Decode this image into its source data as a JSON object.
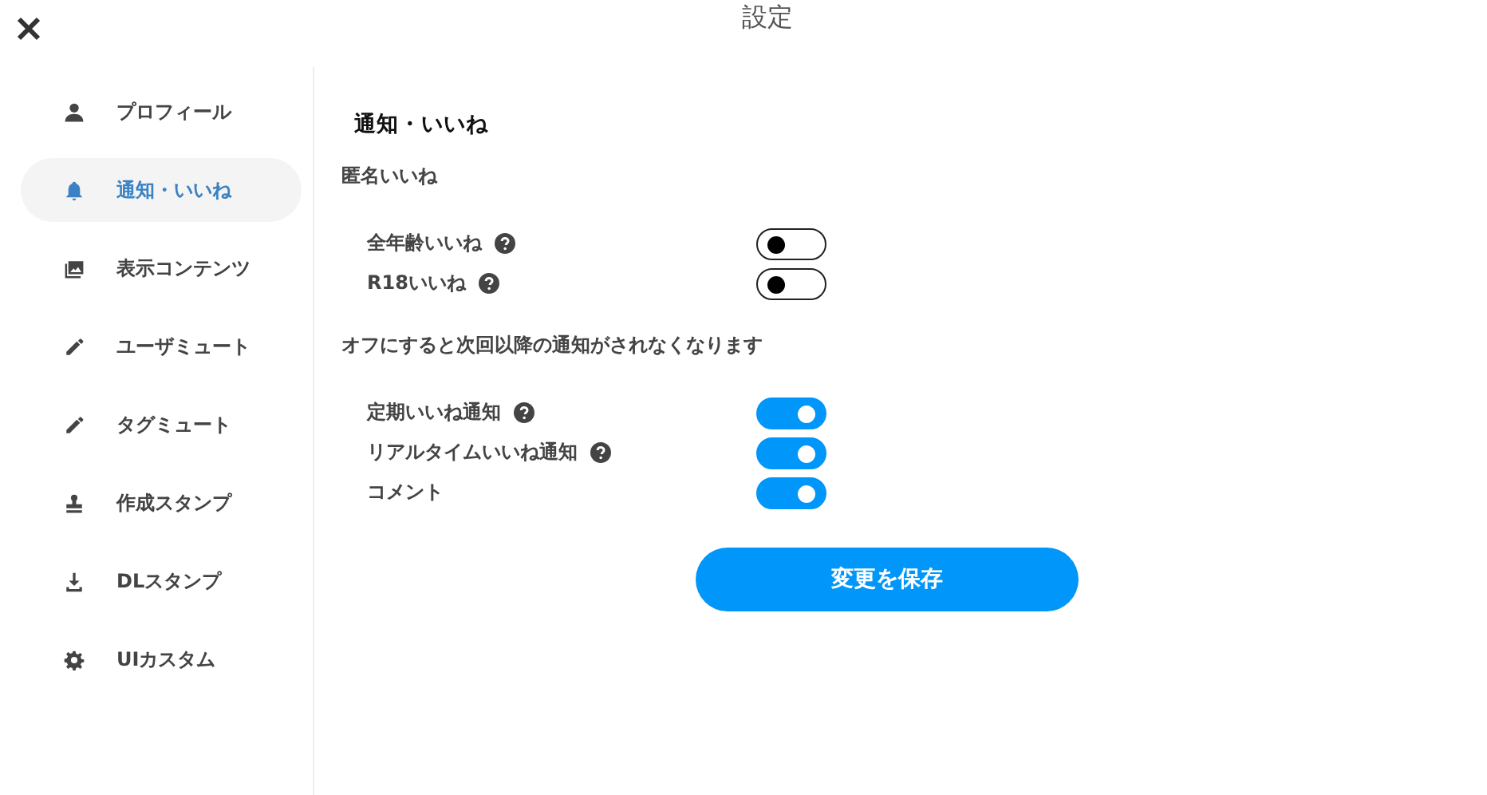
{
  "window": {
    "title": "設定"
  },
  "sidebar": {
    "items": [
      {
        "label": "プロフィール",
        "selected": false
      },
      {
        "label": "通知・いいね",
        "selected": true
      },
      {
        "label": "表示コンテンツ",
        "selected": false
      },
      {
        "label": "ユーザミュート",
        "selected": false
      },
      {
        "label": "タグミュート",
        "selected": false
      },
      {
        "label": "作成スタンプ",
        "selected": false
      },
      {
        "label": "DLスタンプ",
        "selected": false
      },
      {
        "label": "UIカスタム",
        "selected": false
      }
    ]
  },
  "content": {
    "heading": "通知・いいね",
    "sections": [
      {
        "title": "匿名いいね",
        "rows": [
          {
            "label": "全年齢いいね",
            "help": true,
            "on": false
          },
          {
            "label": "R18いいね",
            "help": true,
            "on": false
          }
        ]
      },
      {
        "title": "オフにすると次回以降の通知がされなくなります",
        "rows": [
          {
            "label": "定期いいね通知",
            "help": true,
            "on": true
          },
          {
            "label": "リアルタイムいいね通知",
            "help": true,
            "on": true
          },
          {
            "label": "コメント",
            "help": false,
            "on": true
          }
        ]
      }
    ],
    "save_button": "変更を保存"
  }
}
